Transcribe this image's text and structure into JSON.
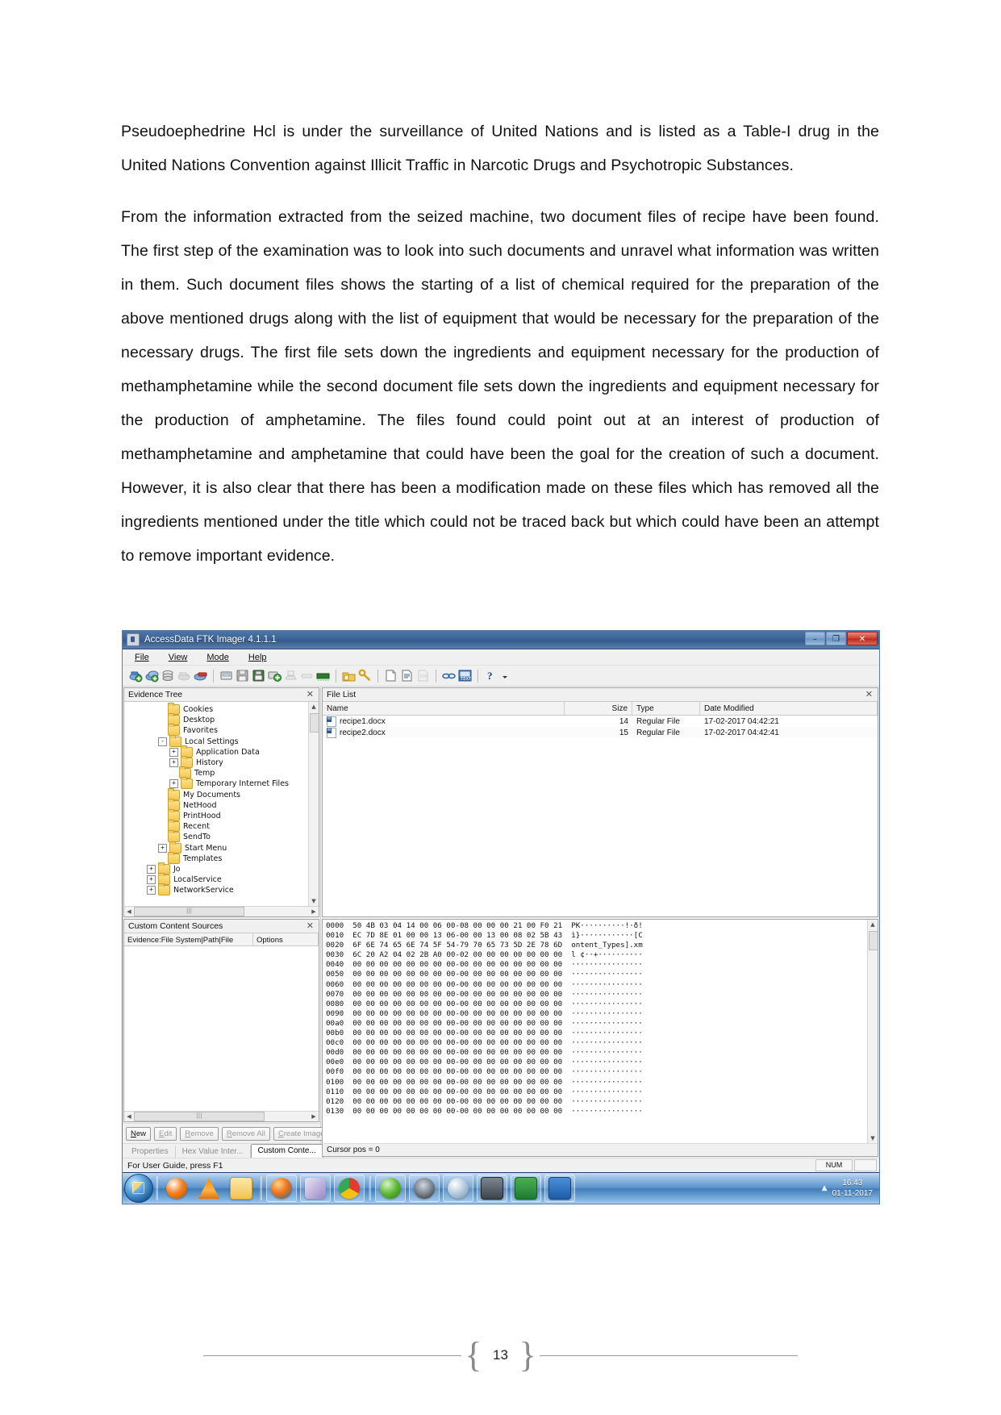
{
  "document": {
    "paragraphs": [
      "Pseudoephedrine Hcl is under the surveillance of United Nations and is listed as a Table-I drug in the United Nations Convention against Illicit Traffic in Narcotic Drugs and Psychotropic Substances.",
      "From the information extracted from the seized machine, two document files of recipe have been found. The first step of the examination was to look into such documents and unravel what information was written in them. Such document files shows the starting of a list of chemical required for the preparation of the above mentioned drugs along with the list of equipment that would be necessary for the preparation of the necessary drugs. The first file sets down the ingredients and equipment necessary for the production of methamphetamine while the second document file sets down the ingredients and equipment necessary for the production of amphetamine. The files found could point out at an interest of production of methamphetamine and amphetamine that could have been the goal for the creation of such a document. However, it is also clear that there has been a modification made on these files which has removed all the ingredients mentioned under the title which could not be traced back but which could have been an attempt to remove important evidence."
    ],
    "page_number": "13"
  },
  "ftk": {
    "window": {
      "title": "AccessData FTK Imager 4.1.1.1",
      "icon": "ftk-app-icon",
      "controls": {
        "minimize": "–",
        "maximize": "❐",
        "close": "✕"
      }
    },
    "menu": [
      "File",
      "View",
      "Mode",
      "Help"
    ],
    "toolbar_icons": [
      "add-evidence-item-icon",
      "add-all-attached-devices-icon",
      "image-mounting-icon",
      "remove-evidence-item-icon",
      "remove-all-evidence-items-icon",
      "create-disk-image-icon",
      "export-disk-image-icon",
      "export-logical-image-icon",
      "add-to-custom-content-image-icon",
      "create-custom-content-image-icon",
      "decrypt-ad1-image-icon",
      "verify-drive-image-icon",
      "capture-memory-icon",
      "obtain-protected-files-icon",
      "detect-efs-encryption-icon",
      "export-files-icon",
      "export-file-hash-list-icon",
      "export-directory-listing-icon",
      "properties-icon",
      "hex-value-interpreter-icon",
      "help-icon",
      "dropdown-arrow-icon"
    ],
    "evidence_tree": {
      "title": "Evidence Tree",
      "close_icon": "close-icon",
      "nodes": [
        {
          "label": "Cookies",
          "depth": 3,
          "expander": ""
        },
        {
          "label": "Desktop",
          "depth": 3,
          "expander": ""
        },
        {
          "label": "Favorites",
          "depth": 3,
          "expander": ""
        },
        {
          "label": "Local Settings",
          "depth": 3,
          "expander": "-"
        },
        {
          "label": "Application Data",
          "depth": 4,
          "expander": "+"
        },
        {
          "label": "History",
          "depth": 4,
          "expander": "+"
        },
        {
          "label": "Temp",
          "depth": 4,
          "expander": ""
        },
        {
          "label": "Temporary Internet Files",
          "depth": 4,
          "expander": "+"
        },
        {
          "label": "My Documents",
          "depth": 3,
          "expander": ""
        },
        {
          "label": "NetHood",
          "depth": 3,
          "expander": ""
        },
        {
          "label": "PrintHood",
          "depth": 3,
          "expander": ""
        },
        {
          "label": "Recent",
          "depth": 3,
          "expander": ""
        },
        {
          "label": "SendTo",
          "depth": 3,
          "expander": ""
        },
        {
          "label": "Start Menu",
          "depth": 3,
          "expander": "+"
        },
        {
          "label": "Templates",
          "depth": 3,
          "expander": ""
        },
        {
          "label": "Jo",
          "depth": 2,
          "expander": "+"
        },
        {
          "label": "LocalService",
          "depth": 2,
          "expander": "+"
        },
        {
          "label": "NetworkService",
          "depth": 2,
          "expander": "+"
        }
      ]
    },
    "custom_content_sources": {
      "title": "Custom Content Sources",
      "close_icon": "close-icon",
      "columns": [
        "Evidence:File System|Path|File",
        "Options"
      ],
      "rows": [],
      "buttons": [
        {
          "label": "New",
          "enabled": true
        },
        {
          "label": "Edit",
          "enabled": false
        },
        {
          "label": "Remove",
          "enabled": false
        },
        {
          "label": "Remove All",
          "enabled": false
        },
        {
          "label": "Create Image",
          "enabled": false
        }
      ]
    },
    "tabs": [
      {
        "label": "Properties",
        "active": false
      },
      {
        "label": "Hex Value Inter...",
        "active": false
      },
      {
        "label": "Custom Conte...",
        "active": true
      }
    ],
    "file_list": {
      "title": "File List",
      "close_icon": "close-icon",
      "columns": [
        "Name",
        "Size",
        "Type",
        "Date Modified"
      ],
      "rows": [
        {
          "name": "recipe1.docx",
          "size": "14",
          "type": "Regular File",
          "date": "17-02-2017 04:42:21",
          "icon": "word-doc-icon"
        },
        {
          "name": "recipe2.docx",
          "size": "15",
          "type": "Regular File",
          "date": "17-02-2017 04:42:41",
          "icon": "word-doc-icon"
        }
      ]
    },
    "hex_view": {
      "lines": [
        {
          "offset": "0000",
          "bytes": "50 4B 03 04 14 00 06 00-08 00 00 00 21 00 F0 21",
          "ascii": "PK··········!·ð!"
        },
        {
          "offset": "0010",
          "bytes": "EC 7D 8E 01 00 00 13 06-00 00 13 00 08 02 5B 43",
          "ascii": "ì}············[C"
        },
        {
          "offset": "0020",
          "bytes": "6F 6E 74 65 6E 74 5F 54-79 70 65 73 5D 2E 78 6D",
          "ascii": "ontent_Types].xm"
        },
        {
          "offset": "0030",
          "bytes": "6C 20 A2 04 02 2B A0 00-02 00 00 00 00 00 00 00",
          "ascii": "l ¢··+··········"
        },
        {
          "offset": "0040",
          "bytes": "00 00 00 00 00 00 00 00-00 00 00 00 00 00 00 00",
          "ascii": "················"
        },
        {
          "offset": "0050",
          "bytes": "00 00 00 00 00 00 00 00-00 00 00 00 00 00 00 00",
          "ascii": "················"
        },
        {
          "offset": "0060",
          "bytes": "00 00 00 00 00 00 00 00-00 00 00 00 00 00 00 00",
          "ascii": "················"
        },
        {
          "offset": "0070",
          "bytes": "00 00 00 00 00 00 00 00-00 00 00 00 00 00 00 00",
          "ascii": "················"
        },
        {
          "offset": "0080",
          "bytes": "00 00 00 00 00 00 00 00-00 00 00 00 00 00 00 00",
          "ascii": "················"
        },
        {
          "offset": "0090",
          "bytes": "00 00 00 00 00 00 00 00-00 00 00 00 00 00 00 00",
          "ascii": "················"
        },
        {
          "offset": "00a0",
          "bytes": "00 00 00 00 00 00 00 00-00 00 00 00 00 00 00 00",
          "ascii": "················"
        },
        {
          "offset": "00b0",
          "bytes": "00 00 00 00 00 00 00 00-00 00 00 00 00 00 00 00",
          "ascii": "················"
        },
        {
          "offset": "00c0",
          "bytes": "00 00 00 00 00 00 00 00-00 00 00 00 00 00 00 00",
          "ascii": "················"
        },
        {
          "offset": "00d0",
          "bytes": "00 00 00 00 00 00 00 00-00 00 00 00 00 00 00 00",
          "ascii": "················"
        },
        {
          "offset": "00e0",
          "bytes": "00 00 00 00 00 00 00 00-00 00 00 00 00 00 00 00",
          "ascii": "················"
        },
        {
          "offset": "00f0",
          "bytes": "00 00 00 00 00 00 00 00-00 00 00 00 00 00 00 00",
          "ascii": "················"
        },
        {
          "offset": "0100",
          "bytes": "00 00 00 00 00 00 00 00-00 00 00 00 00 00 00 00",
          "ascii": "················"
        },
        {
          "offset": "0110",
          "bytes": "00 00 00 00 00 00 00 00-00 00 00 00 00 00 00 00",
          "ascii": "················"
        },
        {
          "offset": "0120",
          "bytes": "00 00 00 00 00 00 00 00-00 00 00 00 00 00 00 00",
          "ascii": "················"
        },
        {
          "offset": "0130",
          "bytes": "00 00 00 00 00 00 00 00-00 00 00 00 00 00 00 00",
          "ascii": "················"
        }
      ],
      "cursor_status": "Cursor pos = 0"
    },
    "status_bar": {
      "message": "For User Guide, press F1",
      "indicators": [
        "NUM",
        ""
      ]
    },
    "taskbar": {
      "start_icon": "windows-start-orb-icon",
      "quick_launch": [
        "media-player-icon",
        "vlc-cone-icon",
        "file-explorer-icon"
      ],
      "apps": [
        "firefox-icon",
        "email-client-icon",
        "chrome-icon",
        "utorrent-icon",
        "tor-browser-icon",
        "antivirus-icon",
        "ftk-imager-icon",
        "excel-icon",
        "word-icon"
      ],
      "tray_arrow": "show-hidden-icons-arrow",
      "time": "16:43",
      "date": "01-11-2017"
    }
  },
  "colors": {
    "title_blue": "#3d6396",
    "close_red": "#cf4434",
    "folder_yellow": "#f5c951",
    "taskbar_blue": "#417cba"
  }
}
